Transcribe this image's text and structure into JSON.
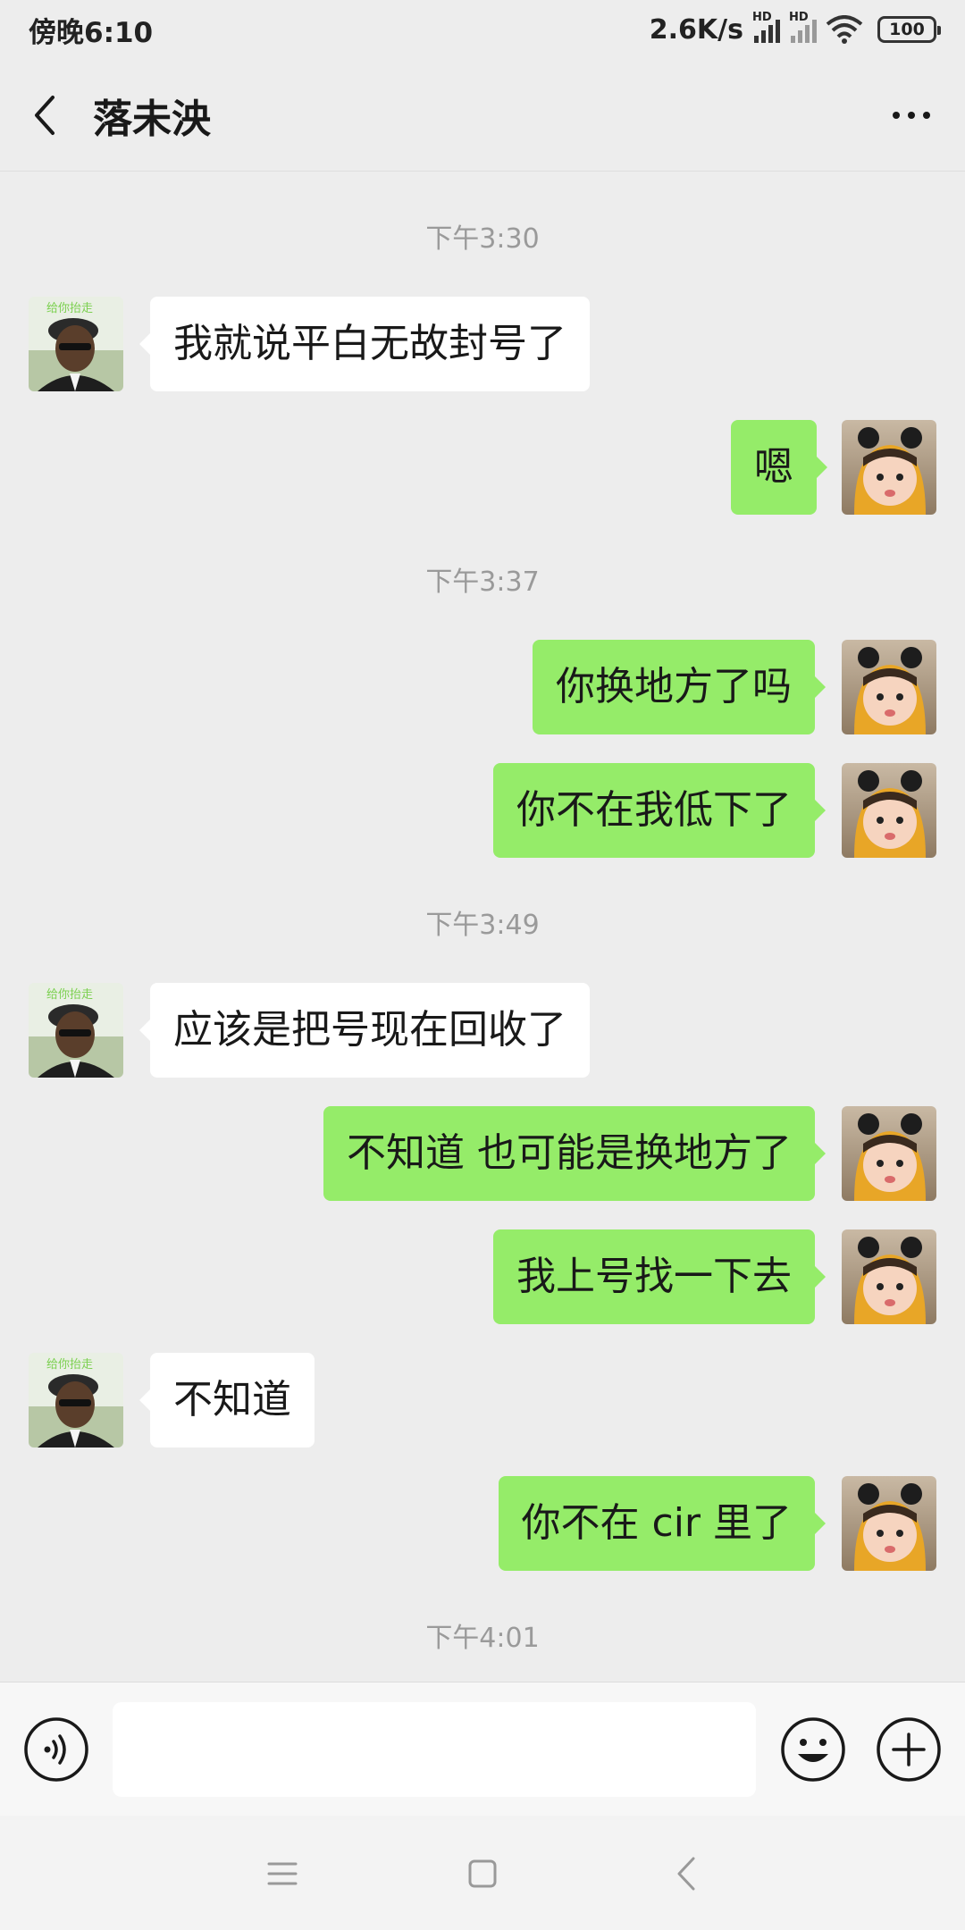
{
  "status_bar": {
    "time": "傍晚6:10",
    "net_speed": "2.6K/s",
    "hd_label": "HD",
    "battery": "100"
  },
  "header": {
    "title": "落未泱"
  },
  "messages": [
    {
      "type": "timestamp",
      "text": "下午3:30"
    },
    {
      "type": "in",
      "text": "我就说平白无故封号了"
    },
    {
      "type": "out",
      "text": "嗯"
    },
    {
      "type": "timestamp",
      "text": "下午3:37"
    },
    {
      "type": "out",
      "text": "你换地方了吗"
    },
    {
      "type": "out",
      "text": "你不在我低下了"
    },
    {
      "type": "timestamp",
      "text": "下午3:49"
    },
    {
      "type": "in",
      "text": "应该是把号现在回收了"
    },
    {
      "type": "out",
      "text": "不知道 也可能是换地方了"
    },
    {
      "type": "out",
      "text": "我上号找一下去"
    },
    {
      "type": "in",
      "text": "不知道"
    },
    {
      "type": "out",
      "text": "你不在 cir 里了"
    },
    {
      "type": "timestamp",
      "text": "下午4:01"
    }
  ],
  "avatars": {
    "contact_overlay_text": "给你抬走"
  },
  "input": {
    "value": "",
    "placeholder": ""
  },
  "colors": {
    "background": "#ededed",
    "outgoing_bubble": "#95ec69",
    "incoming_bubble": "#ffffff",
    "timestamp": "#9a9a9a"
  },
  "icons": {
    "back": "chevron-left-icon",
    "more": "more-icon",
    "voice": "voice-icon",
    "emoji": "emoji-icon",
    "plus": "plus-icon",
    "nav_menu": "menu-icon",
    "nav_home": "home-icon",
    "nav_back": "back-icon"
  }
}
